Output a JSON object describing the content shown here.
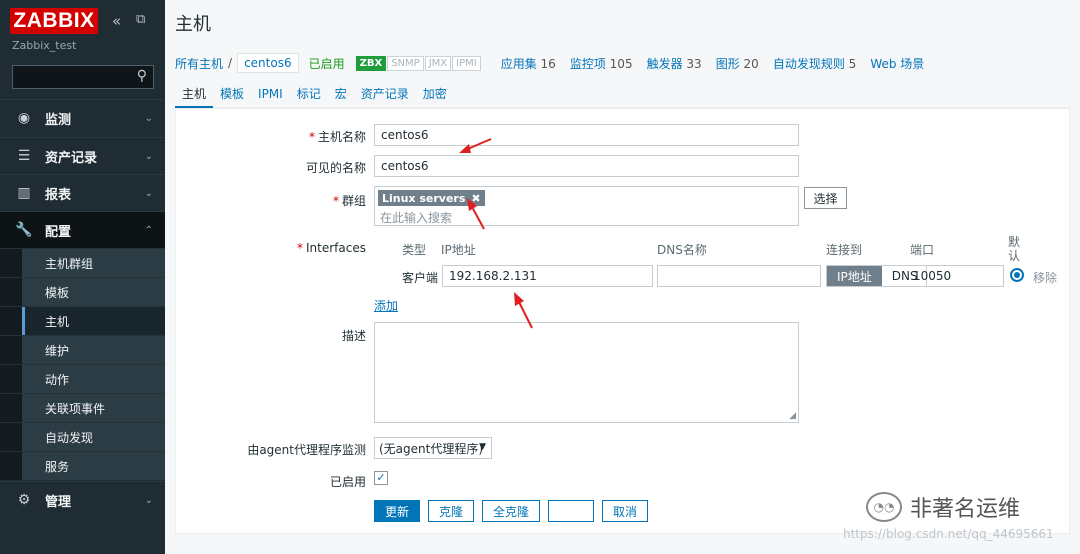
{
  "sidebar": {
    "logo": "ZABBIX",
    "server_name": "Zabbix_test",
    "menu": [
      {
        "label": "监测"
      },
      {
        "label": "资产记录"
      },
      {
        "label": "报表"
      },
      {
        "label": "配置"
      },
      {
        "label": "管理"
      }
    ],
    "config_submenu": [
      "主机群组",
      "模板",
      "主机",
      "维护",
      "动作",
      "关联项事件",
      "自动发现",
      "服务"
    ]
  },
  "header": {
    "title": "主机"
  },
  "breadcrumb": {
    "all_hosts": "所有主机",
    "separator": "/",
    "current": "centos6",
    "status": "已启用"
  },
  "availability": [
    "ZBX",
    "SNMP",
    "JMX",
    "IPMI"
  ],
  "host_nav": [
    {
      "label": "应用集",
      "count": "16"
    },
    {
      "label": "监控项",
      "count": "105"
    },
    {
      "label": "触发器",
      "count": "33"
    },
    {
      "label": "图形",
      "count": "20"
    },
    {
      "label": "自动发现规则",
      "count": "5"
    },
    {
      "label": "Web 场景",
      "count": ""
    }
  ],
  "tabs": [
    "主机",
    "模板",
    "IPMI",
    "标记",
    "宏",
    "资产记录",
    "加密"
  ],
  "form": {
    "host_name_label": "主机名称",
    "host_name": "centos6",
    "visible_name_label": "可见的名称",
    "visible_name": "centos6",
    "groups_label": "群组",
    "group_chip": "Linux servers",
    "group_placeholder": "在此输入搜索",
    "select_button": "选择",
    "interfaces_label": "Interfaces",
    "iface_headers": {
      "type": "类型",
      "ip": "IP地址",
      "dns": "DNS名称",
      "connect": "连接到",
      "port": "端口",
      "default": "默认"
    },
    "iface_type": "客户端",
    "iface_ip": "192.168.2.131",
    "iface_dns": "",
    "connect_ip": "IP地址",
    "connect_dns": "DNS",
    "iface_port": "10050",
    "remove_link": "移除",
    "add_link": "添加",
    "description_label": "描述",
    "proxy_label": "由agent代理程序监测",
    "proxy_value": "(无agent代理程序)",
    "enabled_label": "已启用",
    "buttons": {
      "update": "更新",
      "clone": "克隆",
      "full_clone": "全克隆",
      "delete": "",
      "cancel": "取消"
    }
  },
  "watermark": {
    "text": "非著名运维",
    "url": "https://blog.csdn.net/qq_44695661"
  },
  "colors": {
    "accent": "#0275b8",
    "brand": "#d40000",
    "sidebar": "#1f2c33",
    "enabled": "#1a9c1a"
  }
}
